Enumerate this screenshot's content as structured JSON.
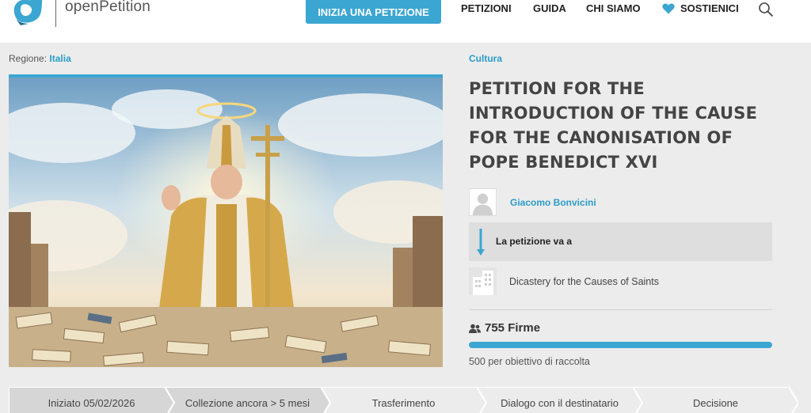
{
  "header": {
    "logo_text": "openPetition",
    "cta_label": "INIZIA UNA PETIZIONE",
    "nav": {
      "petizioni": "PETIZIONI",
      "guida": "GUIDA",
      "chi_siamo": "CHI SIAMO",
      "sostienici": "SOSTIENICI"
    },
    "accent": "#3ba6d1"
  },
  "region": {
    "label": "Regione:",
    "value": "Italia"
  },
  "petition": {
    "category": "Cultura",
    "title": "PETITION FOR THE INTRODUCTION OF THE CAUSE FOR THE CANONISATION OF POPE BENEDICT XVI",
    "author": "Giacomo Bonvicini",
    "goes_to_label": "La petizione va a",
    "recipient": "Dicastery for the Causes of Saints",
    "signatures": "755 Firme",
    "goal_text": "500 per obiettivo di raccolta",
    "progress_fraction": 1.0
  },
  "steps": [
    {
      "label": "Iniziato 05/02/2026",
      "active": true
    },
    {
      "label": "Collezione ancora > 5 mesi",
      "active": true
    },
    {
      "label": "Trasferimento",
      "active": false
    },
    {
      "label": "Dialogo con il destinatario",
      "active": false
    },
    {
      "label": "Decisione",
      "active": false
    }
  ]
}
